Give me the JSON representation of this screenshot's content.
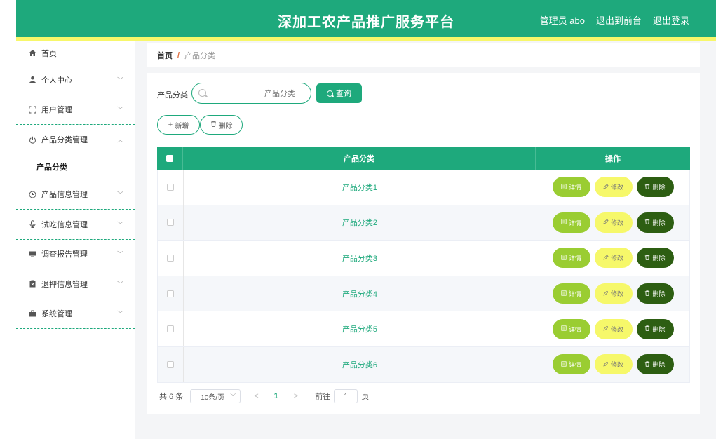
{
  "header": {
    "title": "深加工农产品推广服务平台",
    "admin": "管理员 abo",
    "exit_front": "退出到前台",
    "logout": "退出登录",
    "colors": {
      "primary": "#1ea97c",
      "stripe": "#f7f76a"
    }
  },
  "sidebar": {
    "items": [
      {
        "label": "首页",
        "icon": "home-icon"
      },
      {
        "label": "个人中心",
        "icon": "user-icon"
      },
      {
        "label": "用户管理",
        "icon": "scan-frame-icon"
      },
      {
        "label": "产品分类管理",
        "icon": "power-icon",
        "expanded": true,
        "children": [
          "产品分类"
        ]
      },
      {
        "label": "产品信息管理",
        "icon": "clock-icon"
      },
      {
        "label": "试吃信息管理",
        "icon": "microphone-icon"
      },
      {
        "label": "调查报告管理",
        "icon": "monitor-icon"
      },
      {
        "label": "退押信息管理",
        "icon": "clipboard-icon"
      },
      {
        "label": "系统管理",
        "icon": "briefcase-icon"
      }
    ]
  },
  "breadcrumb": {
    "home": "首页",
    "sep": "/",
    "current": "产品分类"
  },
  "search": {
    "label": "产品分类",
    "placeholder": "产品分类",
    "value": "",
    "button": "查询"
  },
  "actions": {
    "add": "新增",
    "delete": "删除"
  },
  "table": {
    "headers": {
      "name": "产品分类",
      "ops": "操作"
    },
    "rows": [
      "产品分类1",
      "产品分类2",
      "产品分类3",
      "产品分类4",
      "产品分类5",
      "产品分类6"
    ],
    "op_labels": {
      "detail": "详情",
      "edit": "修改",
      "delete": "删除"
    }
  },
  "pagination": {
    "total": "共 6 条",
    "page_size": "10条/页",
    "prev": "<",
    "current_page": "1",
    "next": ">",
    "goto_prefix": "前往",
    "goto_value": "1",
    "goto_suffix": "页"
  }
}
